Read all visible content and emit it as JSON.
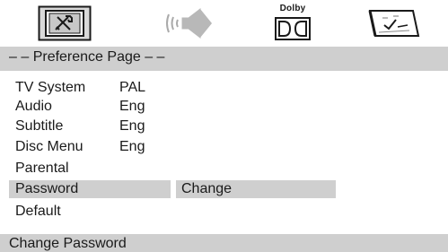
{
  "icons": [
    {
      "name": "tv-setup-icon"
    },
    {
      "name": "speaker-icon"
    },
    {
      "name": "dolby-icon",
      "label": "Dolby"
    },
    {
      "name": "preference-icon"
    }
  ],
  "page": {
    "header": "– – Preference Page – –"
  },
  "menu": {
    "items": [
      {
        "label": "TV System",
        "value": "PAL"
      },
      {
        "label": "Audio",
        "value": "Eng"
      },
      {
        "label": "Subtitle",
        "value": "Eng"
      },
      {
        "label": "Disc Menu",
        "value": "Eng"
      },
      {
        "label": "Parental",
        "value": ""
      },
      {
        "label": "Password",
        "value": ""
      },
      {
        "label": "Default",
        "value": ""
      }
    ],
    "selected_index": 5,
    "submenu_option": "Change"
  },
  "status": {
    "text": "Change Password"
  },
  "colors": {
    "highlight": "#cfcfcf",
    "background": "#ffffff",
    "text": "#1a1a1a"
  }
}
